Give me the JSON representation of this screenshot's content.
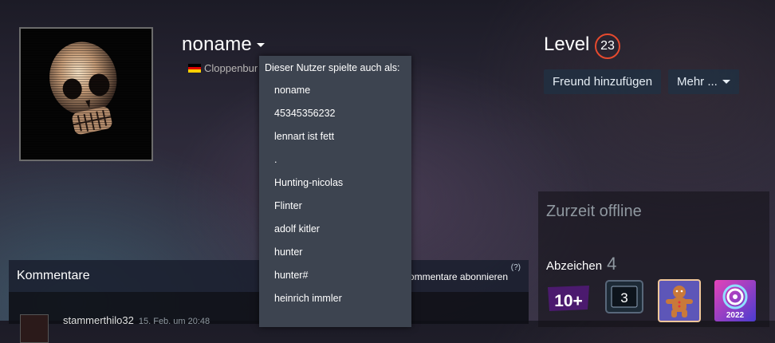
{
  "profile": {
    "name": "noname",
    "location": "Cloppenbur",
    "flag_colors": [
      "#000000",
      "#dd0000",
      "#ffce00"
    ]
  },
  "level": {
    "label": "Level",
    "value": "23",
    "ring_color": "#e64a2e"
  },
  "actions": {
    "add_friend": "Freund hinzufügen",
    "more": "Mehr ..."
  },
  "aliases": {
    "header": "Dieser Nutzer spielte auch als:",
    "items": [
      "noname",
      "45345356232",
      "lennart ist fett",
      ".",
      "Hunting-nicolas",
      "Flinter",
      "adolf kitler",
      "hunter",
      "hunter#",
      "heinrich immler"
    ]
  },
  "summary": {
    "status": "Zurzeit offline",
    "badges_label": "Abzeichen",
    "badges_count": "4",
    "badges": [
      {
        "name": "years-of-service-badge",
        "text": "10+"
      },
      {
        "name": "level-3-badge",
        "text": "3"
      },
      {
        "name": "gingerbread-badge",
        "text": ""
      },
      {
        "name": "steam-replay-badge",
        "text": "2022"
      }
    ]
  },
  "comments": {
    "title": "Kommentare",
    "subscribe": "Kommentare abonnieren",
    "help": "(?)",
    "first": {
      "author": "stammerthilo32",
      "date": "15. Feb. um 20:48"
    }
  },
  "icons": [
    "skull-avatar",
    "caret-down-icon",
    "flag-icon",
    "help-icon"
  ]
}
